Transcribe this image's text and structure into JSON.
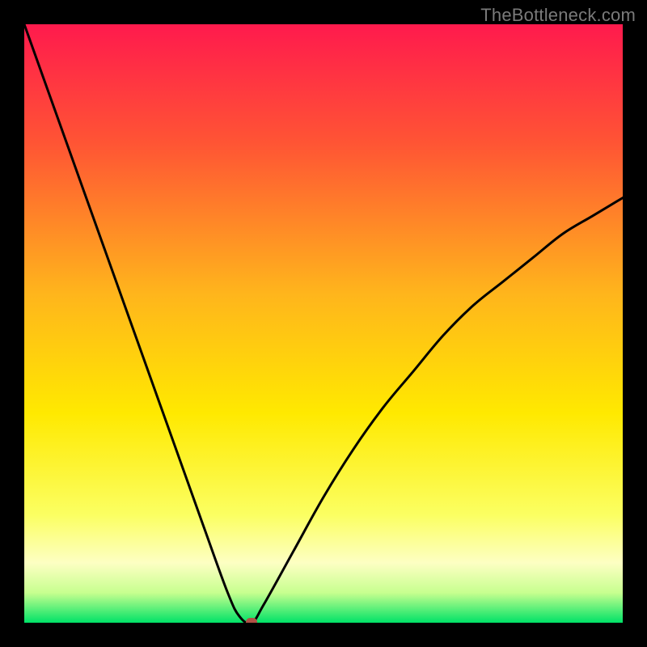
{
  "watermark": "TheBottleneck.com",
  "chart_data": {
    "type": "line",
    "title": "",
    "xlabel": "",
    "ylabel": "",
    "xlim": [
      0,
      100
    ],
    "ylim": [
      0,
      100
    ],
    "grid": false,
    "legend": false,
    "series": [
      {
        "name": "bottleneck-curve",
        "x": [
          0,
          5,
          10,
          15,
          20,
          25,
          30,
          34,
          36,
          38,
          40,
          45,
          50,
          55,
          60,
          65,
          70,
          75,
          80,
          85,
          90,
          95,
          100
        ],
        "y": [
          100,
          86,
          72,
          58,
          44,
          30,
          16,
          5,
          1,
          0,
          3,
          12,
          21,
          29,
          36,
          42,
          48,
          53,
          57,
          61,
          65,
          68,
          71
        ]
      }
    ],
    "background_gradient": {
      "stops": [
        {
          "pct": 0,
          "color": "#ff1a4d"
        },
        {
          "pct": 20,
          "color": "#ff5534"
        },
        {
          "pct": 45,
          "color": "#ffb51c"
        },
        {
          "pct": 65,
          "color": "#ffe900"
        },
        {
          "pct": 82,
          "color": "#fbff62"
        },
        {
          "pct": 90,
          "color": "#fdffc3"
        },
        {
          "pct": 95,
          "color": "#c7ff8f"
        },
        {
          "pct": 100,
          "color": "#00e267"
        }
      ]
    },
    "marker": {
      "x": 38,
      "y": 0,
      "color": "#b15045"
    },
    "curve_color": "#000000",
    "curve_width": 3
  }
}
